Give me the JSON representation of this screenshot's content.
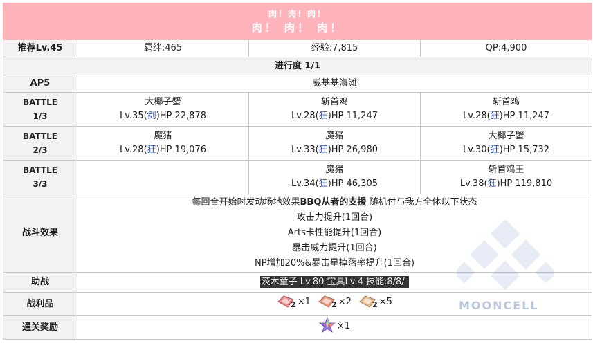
{
  "quest": {
    "title_jp": "肉！肉！肉！",
    "title_cn": "肉！ 肉！ 肉！"
  },
  "info": {
    "recommended": "推荐Lv.45",
    "bond": "羁绊:465",
    "exp": "经验:7,815",
    "qp": "QP:4,900"
  },
  "progress": "进行度 1/1",
  "ap": "AP5",
  "location": "威基基海滩",
  "battles": [
    {
      "label_top": "BATTLE",
      "label_bottom": "1/3",
      "enemies": [
        {
          "name": "大椰子蟹",
          "lv": "Lv.35(",
          "cls": "剑",
          "hp": ")HP 22,878"
        },
        {
          "name": "斩首鸡",
          "lv": "Lv.28(",
          "cls": "狂",
          "hp": ")HP 11,247"
        },
        {
          "name": "斩首鸡",
          "lv": "Lv.28(",
          "cls": "狂",
          "hp": ")HP 11,247"
        }
      ]
    },
    {
      "label_top": "BATTLE",
      "label_bottom": "2/3",
      "enemies": [
        {
          "name": "魔猪",
          "lv": "Lv.28(",
          "cls": "狂",
          "hp": ")HP 19,076"
        },
        {
          "name": "魔猪",
          "lv": "Lv.33(",
          "cls": "狂",
          "hp": ")HP 26,980"
        },
        {
          "name": "大椰子蟹",
          "lv": "Lv.30(",
          "cls": "狂",
          "hp": ")HP 15,732"
        }
      ]
    },
    {
      "label_top": "BATTLE",
      "label_bottom": "3/3",
      "enemies": [
        {
          "name": "",
          "lv": "",
          "cls": "",
          "hp": ""
        },
        {
          "name": "魔猪",
          "lv": "Lv.34(",
          "cls": "狂",
          "hp": ")HP 46,305"
        },
        {
          "name": "斩首鸡王",
          "lv": "Lv.38(",
          "cls": "狂",
          "hp": ")HP 119,810"
        }
      ]
    }
  ],
  "effect": {
    "label": "战斗效果",
    "intro_pre": "每回合开始时发动场地效果",
    "intro_bold": "BBQ从者的支援",
    "intro_post": " 随机付与我方全体以下状态",
    "lines": [
      "攻击力提升(1回合)",
      "Arts卡性能提升(1回合)",
      "暴击威力提升(1回合)",
      "NP增加20%&暴击星掉落率提升(1回合)"
    ]
  },
  "support": {
    "label": "助战",
    "value": "茨木童子 Lv.80 宝具Lv.4 技能:8/8/-"
  },
  "drops": {
    "label": "战利品",
    "items": [
      {
        "icon": "meat-icon-red",
        "count": "2",
        "qty": "×1",
        "color": "#e88a8a"
      },
      {
        "icon": "meat-icon-pink",
        "count": "2",
        "qty": "×2",
        "color": "#e89a80"
      },
      {
        "icon": "meat-icon-tan",
        "count": "2",
        "qty": "×5",
        "color": "#e4b88c"
      }
    ]
  },
  "clear": {
    "label": "通关奖励",
    "icon": "saint-quartz-icon",
    "qty": "×1"
  },
  "watermark": "MOONCELL"
}
